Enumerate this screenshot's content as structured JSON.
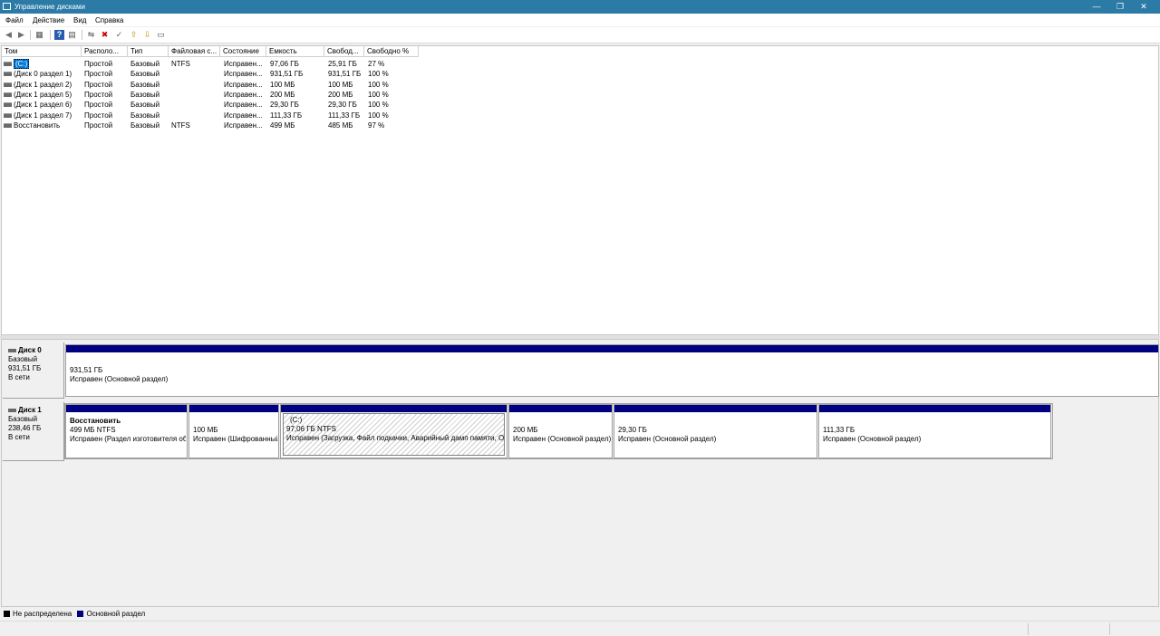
{
  "window": {
    "title": "Управление дисками",
    "minimize": "—",
    "restore": "❐",
    "close": "✕"
  },
  "menu": [
    "Файл",
    "Действие",
    "Вид",
    "Справка"
  ],
  "toolbar": {
    "back": "◀",
    "forward": "▶",
    "properties": "▦",
    "help": "?",
    "view": "▤",
    "connect": "⇋",
    "delete": "✖",
    "check": "✓",
    "import": "⇪",
    "explorer": "⇩",
    "list": "▭"
  },
  "columns": [
    "Том",
    "Располо...",
    "Тип",
    "Файловая с...",
    "Состояние",
    "Емкость",
    "Свобод...",
    "Свободно %"
  ],
  "volumes": [
    [
      "(C:)",
      "Простой",
      "Базовый",
      "NTFS",
      "Исправен...",
      "97,06 ГБ",
      "25,91 ГБ",
      "27 %"
    ],
    [
      "(Диск 0 раздел 1)",
      "Простой",
      "Базовый",
      "",
      "Исправен...",
      "931,51 ГБ",
      "931,51 ГБ",
      "100 %"
    ],
    [
      "(Диск 1 раздел 2)",
      "Простой",
      "Базовый",
      "",
      "Исправен...",
      "100 МБ",
      "100 МБ",
      "100 %"
    ],
    [
      "(Диск 1 раздел 5)",
      "Простой",
      "Базовый",
      "",
      "Исправен...",
      "200 МБ",
      "200 МБ",
      "100 %"
    ],
    [
      "(Диск 1 раздел 6)",
      "Простой",
      "Базовый",
      "",
      "Исправен...",
      "29,30 ГБ",
      "29,30 ГБ",
      "100 %"
    ],
    [
      "(Диск 1 раздел 7)",
      "Простой",
      "Базовый",
      "",
      "Исправен...",
      "111,33 ГБ",
      "111,33 ГБ",
      "100 %"
    ],
    [
      "Восстановить",
      "Простой",
      "Базовый",
      "NTFS",
      "Исправен...",
      "499 МБ",
      "485 МБ",
      "97 %"
    ]
  ],
  "disks": [
    {
      "name": "Диск 0",
      "type": "Базовый",
      "size": "931,51 ГБ",
      "status": "В сети",
      "partitions": [
        {
          "title": "",
          "line1": "931,51 ГБ",
          "line2": "Исправен (Основной раздел)"
        }
      ]
    },
    {
      "name": "Диск 1",
      "type": "Базовый",
      "size": "238,46 ГБ",
      "status": "В сети",
      "partitions": [
        {
          "title": "Восстановить",
          "line1": "499 МБ NTFS",
          "line2": "Исправен (Раздел изготовителя оборудования)"
        },
        {
          "title": "",
          "line1": "100 МБ",
          "line2": "Исправен (Шифрованный (EFI) системный раздел)"
        },
        {
          "title": "(C:)",
          "line1": "97,06 ГБ NTFS",
          "line2": "Исправен (Загрузка, Файл подкачки, Аварийный дамп памяти, Основной раздел)"
        },
        {
          "title": "",
          "line1": "200 МБ",
          "line2": "Исправен (Основной раздел)"
        },
        {
          "title": "",
          "line1": "29,30 ГБ",
          "line2": "Исправен (Основной раздел)"
        },
        {
          "title": "",
          "line1": "111,33 ГБ",
          "line2": "Исправен (Основной раздел)"
        }
      ]
    }
  ],
  "legend": [
    {
      "label": "Не распределена",
      "color": "#000000"
    },
    {
      "label": "Основной раздел",
      "color": "#000080"
    }
  ]
}
